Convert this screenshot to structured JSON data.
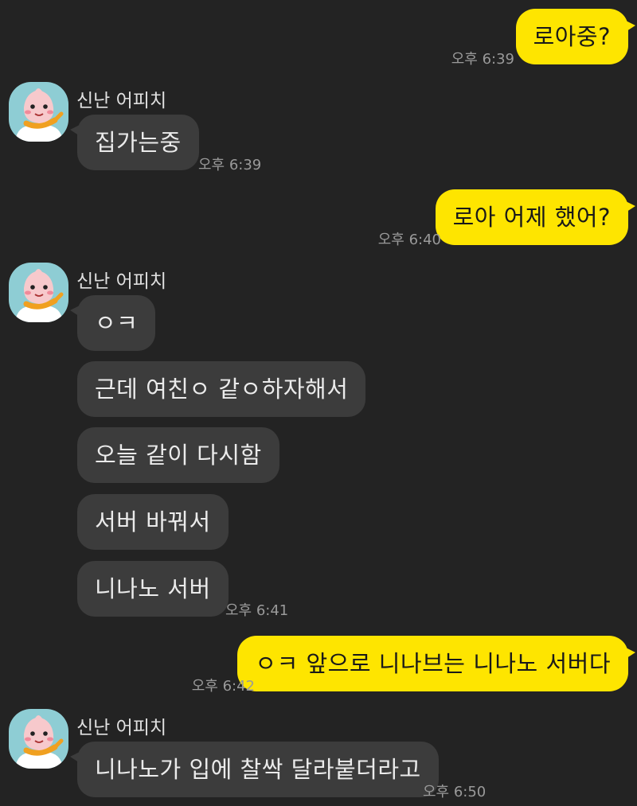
{
  "colors": {
    "background": "#232323",
    "outgoing_bubble": "#fee500",
    "incoming_bubble": "#3c3c3c",
    "avatar_bg": "#8ecdd4"
  },
  "messages": [
    {
      "side": "out",
      "text": "로아중?",
      "time": "오후 6:39"
    },
    {
      "side": "in",
      "sender": "신난 어피치",
      "avatar": "apeach-icon",
      "text": "집가는중",
      "time": "오후 6:39"
    },
    {
      "side": "out",
      "text": "로아 어제 했어?",
      "time": "오후 6:40"
    },
    {
      "side": "in",
      "sender": "신난 어피치",
      "avatar": "apeach-icon",
      "bubbles": [
        "ㅇㅋ",
        "근데 여친ㅇ 같ㅇ하자해서",
        "오늘 같이 다시함",
        "서버 바꿔서",
        "니나노 서버"
      ],
      "time": "오후 6:41"
    },
    {
      "side": "out",
      "text": "ㅇㅋ 앞으로 니나브는 니나노 서버다",
      "time": "오후 6:42"
    },
    {
      "side": "in",
      "sender": "신난 어피치",
      "avatar": "apeach-icon",
      "text": "니나노가 입에 찰싹 달라붙더라고",
      "time": "오후 6:50"
    }
  ]
}
